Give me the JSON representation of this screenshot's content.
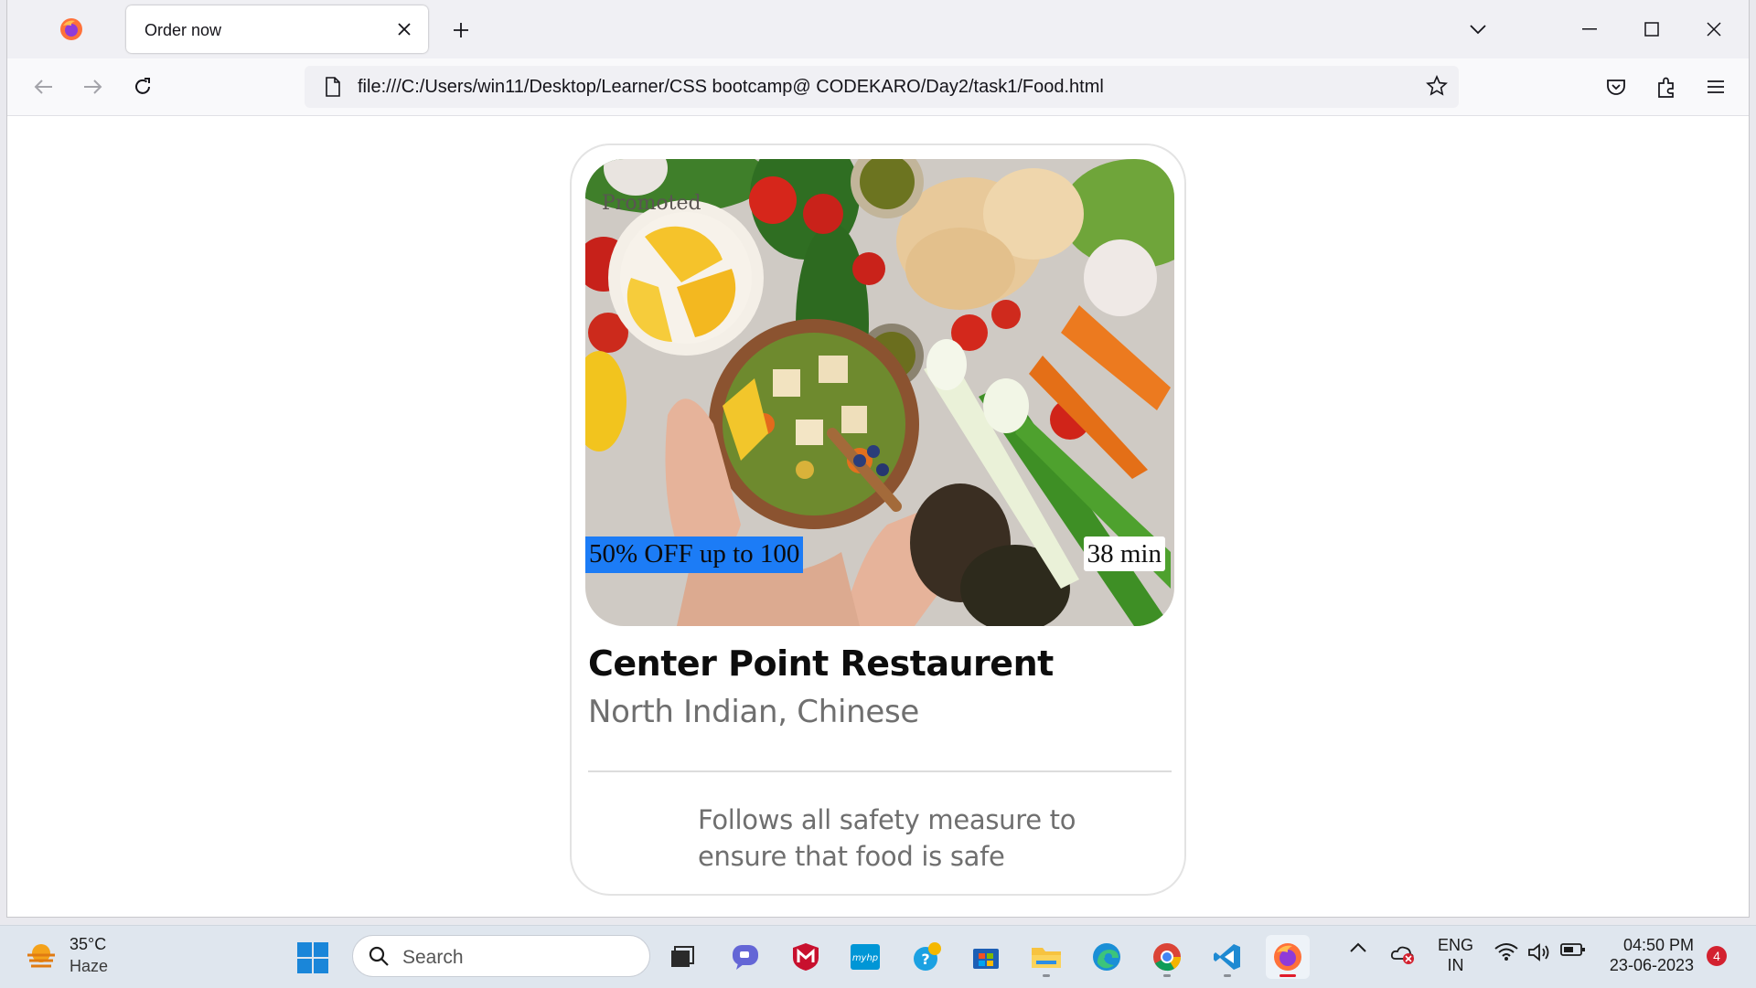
{
  "browser": {
    "tab_title": "Order now",
    "url": "file:///C:/Users/win11/Desktop/Learner/CSS bootcamp@ CODEKARO/Day2/task1/Food.html"
  },
  "card": {
    "badge": "Promoted",
    "offer": "50% OFF up to 100",
    "time": "38 min",
    "name": "Center Point Restaurent",
    "cuisine": "North Indian, Chinese",
    "safety_note": "Follows all safety measure to ensure that food is safe",
    "offer_color": "#1c7cf6"
  },
  "taskbar": {
    "temperature": "35°C",
    "weather": "Haze",
    "search_placeholder": "Search",
    "apps": [
      "task-view-icon",
      "chat-icon",
      "mcafee-icon",
      "myhp-icon",
      "tips-icon",
      "store-icon",
      "file-explorer-icon",
      "edge-icon",
      "chrome-icon",
      "vscode-icon",
      "firefox-icon"
    ],
    "lang_primary": "ENG",
    "lang_secondary": "IN",
    "time": "04:50 PM",
    "date": "23-06-2023",
    "notifications": "4"
  }
}
